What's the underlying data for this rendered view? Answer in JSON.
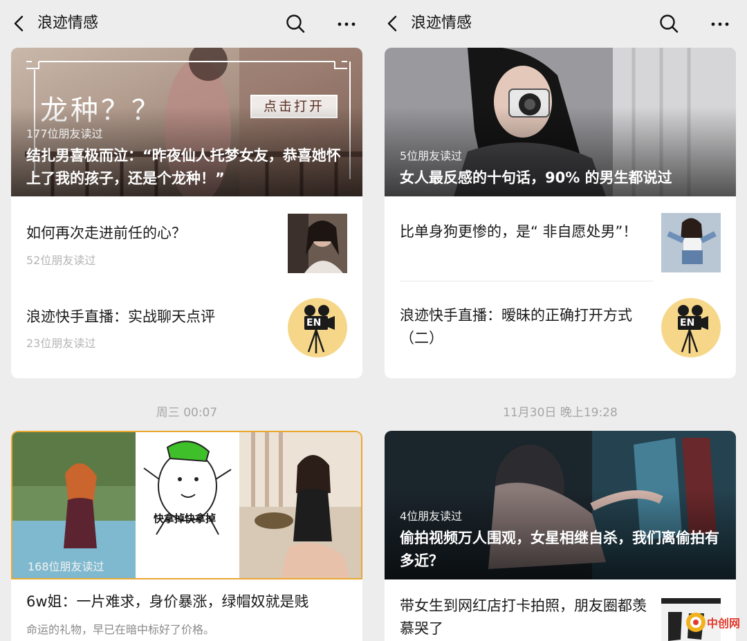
{
  "left": {
    "header": {
      "title": "浪迹情感"
    },
    "card1": {
      "hero": {
        "overlay_text": "龙种？？",
        "button_text": "点击打开",
        "reads": "177位朋友读过",
        "title": "结扎男喜极而泣：“昨夜仙人托梦女友，恭喜她怀上了我的孩子，还是个龙种！”"
      },
      "items": [
        {
          "title": "如何再次走进前任的心？",
          "reads": "52位朋友读过"
        },
        {
          "title": "浪迹快手直播：实战聊天点评",
          "reads": "23位朋友读过"
        }
      ]
    },
    "timestamp": "周三 00:07",
    "card2": {
      "hero": {
        "caption": "快拿掉快拿掉",
        "reads": "168位朋友读过"
      },
      "item": {
        "title": "6w姐：一片难求，身价暴涨，绿帽奴就是贱",
        "subtitle": "命运的礼物，早已在暗中标好了价格。"
      }
    }
  },
  "right": {
    "header": {
      "title": "浪迹情感"
    },
    "card1": {
      "hero": {
        "reads": "5位朋友读过",
        "title": "女人最反感的十句话，90% 的男生都说过"
      },
      "items": [
        {
          "title": "比单身狗更惨的，是“ 非自愿处男”！"
        },
        {
          "title": "浪迹快手直播：暧昧的正确打开方式（二）"
        }
      ]
    },
    "timestamp": "11月30日 晚上19:28",
    "card2": {
      "hero": {
        "reads": "4位朋友读过",
        "title": "偷拍视频万人围观，女星相继自杀，我们离偷拍有多近？"
      },
      "item": {
        "title": "带女生到网红店打卡拍照，朋友圈都羡慕哭了"
      }
    }
  },
  "film_icon_text": "EN",
  "watermark": {
    "text": "中创网"
  },
  "colors": {
    "background": "#ededed",
    "card": "#ffffff",
    "reads_grey": "#b4b4b4",
    "highlight_border": "#e8a730",
    "icon_circle": "#f6d78a"
  }
}
